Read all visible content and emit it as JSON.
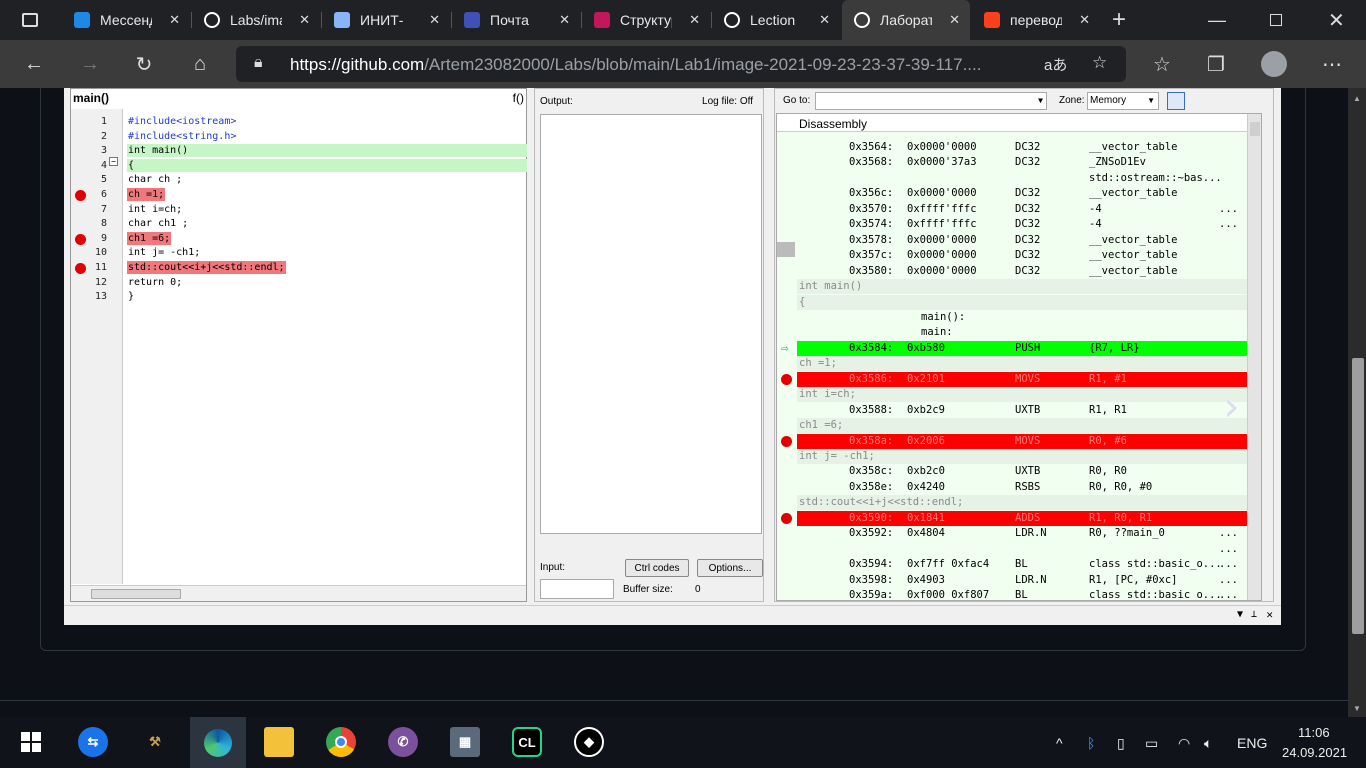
{
  "tabs": [
    {
      "label": "Мессенджер",
      "icon": "messenger-icon",
      "color": "#1e88e5"
    },
    {
      "label": "Labs/image",
      "icon": "github-icon",
      "color": "#ffffff"
    },
    {
      "label": "ИНИТ-",
      "icon": "document-icon",
      "color": "#8ab4f8"
    },
    {
      "label": "Почта",
      "icon": "mail-icon",
      "color": "#3f51b5"
    },
    {
      "label": "Структура",
      "icon": "structure-icon",
      "color": "#c2185b"
    },
    {
      "label": "Lection",
      "icon": "github-icon",
      "color": "#ffffff"
    },
    {
      "label": "Лаборат",
      "icon": "github-icon",
      "color": "#ffffff"
    },
    {
      "label": "перевод",
      "icon": "yandex-icon",
      "color": "#fc3f1d"
    }
  ],
  "address": {
    "url_host": "https://github.com",
    "url_path": "/Artem23082000/Labs/blob/main/Lab1/image-2021-09-23-23-37-39-117...."
  },
  "editor": {
    "title": "main()",
    "func_button": "f()",
    "lines": [
      {
        "n": "1",
        "text": "#include<iostream>",
        "style": "blue",
        "bp": false
      },
      {
        "n": "2",
        "text": "#include<string.h>",
        "style": "blue",
        "bp": false
      },
      {
        "n": "3",
        "text": "int main()",
        "style": "green",
        "bp": false
      },
      {
        "n": "4",
        "text": "{",
        "style": "green",
        "bp": false
      },
      {
        "n": "5",
        "text": "char ch ;",
        "style": "plain",
        "bp": false
      },
      {
        "n": "6",
        "text": "ch =1;",
        "style": "red",
        "bp": true
      },
      {
        "n": "7",
        "text": "int i=ch;",
        "style": "plain",
        "bp": false
      },
      {
        "n": "8",
        "text": "char ch1 ;",
        "style": "plain",
        "bp": false
      },
      {
        "n": "9",
        "text": "ch1 =6;",
        "style": "red",
        "bp": true
      },
      {
        "n": "10",
        "text": "int j= -ch1;",
        "style": "plain",
        "bp": false
      },
      {
        "n": "11",
        "text": "std::cout<<i+j<<std::endl;",
        "style": "red",
        "bp": true
      },
      {
        "n": "12",
        "text": "return 0;",
        "style": "plain",
        "bp": false
      },
      {
        "n": "13",
        "text": "}",
        "style": "plain",
        "bp": false
      }
    ]
  },
  "output": {
    "label": "Output:",
    "log_file": "Log file: Off",
    "input_label": "Input:",
    "ctrl_codes": "Ctrl codes",
    "options": "Options...",
    "buffer_label": "Buffer size:",
    "buffer_value": "0"
  },
  "disasm": {
    "goto_label": "Go to:",
    "zone_label": "Zone:",
    "zone_value": "Memory",
    "header": "Disassembly",
    "rows": [
      {
        "t": "code",
        "addr": "0x3564:",
        "hex": "0x0000'0000",
        "op": "DC32",
        "arg": "__vector_table",
        "more": ""
      },
      {
        "t": "code",
        "addr": "0x3568:",
        "hex": "0x0000'37a3",
        "op": "DC32",
        "arg": "_ZNSoD1Ev",
        "more": ""
      },
      {
        "t": "code",
        "addr": "",
        "hex": "",
        "op": "",
        "arg": "std::ostream::~bas...",
        "more": ""
      },
      {
        "t": "code",
        "addr": "0x356c:",
        "hex": "0x0000'0000",
        "op": "DC32",
        "arg": "__vector_table",
        "more": ""
      },
      {
        "t": "code",
        "addr": "0x3570:",
        "hex": "0xffff'fffc",
        "op": "DC32",
        "arg": "-4",
        "more": "..."
      },
      {
        "t": "code",
        "addr": "0x3574:",
        "hex": "0xffff'fffc",
        "op": "DC32",
        "arg": "-4",
        "more": "..."
      },
      {
        "t": "code",
        "addr": "0x3578:",
        "hex": "0x0000'0000",
        "op": "DC32",
        "arg": "__vector_table",
        "more": ""
      },
      {
        "t": "code",
        "addr": "0x357c:",
        "hex": "0x0000'0000",
        "op": "DC32",
        "arg": "__vector_table",
        "more": ""
      },
      {
        "t": "code",
        "addr": "0x3580:",
        "hex": "0x0000'0000",
        "op": "DC32",
        "arg": "__vector_table",
        "more": ""
      },
      {
        "t": "src",
        "text": "int main()"
      },
      {
        "t": "src",
        "text": "{"
      },
      {
        "t": "label",
        "text": "main():"
      },
      {
        "t": "label",
        "text": "main:"
      },
      {
        "t": "green",
        "addr": "0x3584:",
        "hex": "0xb580",
        "op": "PUSH",
        "arg": "{R7, LR}",
        "more": ""
      },
      {
        "t": "src",
        "text": "ch =1;"
      },
      {
        "t": "red",
        "addr": "0x3586:",
        "hex": "0x2101",
        "op": "MOVS",
        "arg": "R1, #1",
        "more": ""
      },
      {
        "t": "src",
        "text": "int i=ch;"
      },
      {
        "t": "code",
        "addr": "0x3588:",
        "hex": "0xb2c9",
        "op": "UXTB",
        "arg": "R1, R1",
        "more": ""
      },
      {
        "t": "src",
        "text": "ch1 =6;"
      },
      {
        "t": "red",
        "addr": "0x358a:",
        "hex": "0x2006",
        "op": "MOVS",
        "arg": "R0, #6",
        "more": ""
      },
      {
        "t": "src",
        "text": "int j= -ch1;"
      },
      {
        "t": "code",
        "addr": "0x358c:",
        "hex": "0xb2c0",
        "op": "UXTB",
        "arg": "R0, R0",
        "more": ""
      },
      {
        "t": "code",
        "addr": "0x358e:",
        "hex": "0x4240",
        "op": "RSBS",
        "arg": "R0, R0, #0",
        "more": ""
      },
      {
        "t": "src",
        "text": "std::cout<<i+j<<std::endl;"
      },
      {
        "t": "red",
        "addr": "0x3590:",
        "hex": "0x1841",
        "op": "ADDS",
        "arg": "R1, R0, R1",
        "more": ""
      },
      {
        "t": "code",
        "addr": "0x3592:",
        "hex": "0x4804",
        "op": "LDR.N",
        "arg": "R0, ??main_0",
        "more": "..."
      },
      {
        "t": "code",
        "addr": "",
        "hex": "",
        "op": "",
        "arg": "",
        "more": "..."
      },
      {
        "t": "code",
        "addr": "0x3594:",
        "hex": "0xf7ff 0xfac4",
        "op": "BL",
        "arg": "class std::basic_o...",
        "more": "..."
      },
      {
        "t": "code",
        "addr": "0x3598:",
        "hex": "0x4903",
        "op": "LDR.N",
        "arg": "R1, [PC, #0xc]",
        "more": "..."
      },
      {
        "t": "code",
        "addr": "0x359a:",
        "hex": "0xf000 0xf807",
        "op": "BL",
        "arg": "class std::basic_o...",
        "more": "..."
      }
    ]
  },
  "taskbar": {
    "lang": "ENG",
    "time": "11:06",
    "date": "24.09.2021"
  }
}
